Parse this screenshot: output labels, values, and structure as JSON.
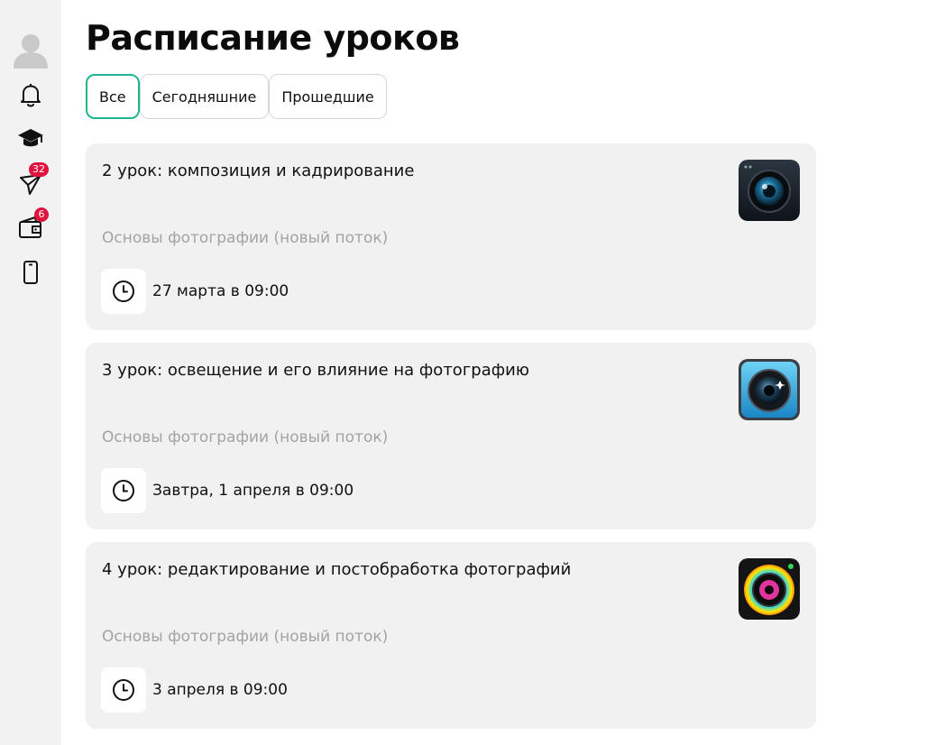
{
  "page": {
    "title": "Расписание уроков"
  },
  "sidebar": {
    "items": [
      {
        "icon": "avatar"
      },
      {
        "icon": "bell-icon"
      },
      {
        "icon": "graduation-cap-icon"
      },
      {
        "icon": "send-icon",
        "badge": "32"
      },
      {
        "icon": "wallet-icon",
        "badge": "6"
      },
      {
        "icon": "phone-icon"
      }
    ],
    "badge_color": "#e0133f"
  },
  "tabs": [
    {
      "label": "Все",
      "active": true
    },
    {
      "label": "Сегодняшние",
      "active": false
    },
    {
      "label": "Прошедшие",
      "active": false
    }
  ],
  "accent_color": "#1fb58f",
  "lessons": [
    {
      "title": "2 урок: композиция и кадрирование",
      "course": "Основы фотографии (новый поток)",
      "time": "27 марта в 09:00",
      "icon": "camera-lens-dark-icon"
    },
    {
      "title": "3 урок: освещение и его влияние на фотографию",
      "course": "Основы фотографии (новый поток)",
      "time": "Завтра, 1 апреля в 09:00",
      "icon": "camera-lens-blue-icon"
    },
    {
      "title": "4 урок: редактирование и постобработка фотографий",
      "course": "Основы фотографии (новый поток)",
      "time": "3 апреля в 09:00",
      "icon": "camera-lens-colorful-icon"
    }
  ]
}
